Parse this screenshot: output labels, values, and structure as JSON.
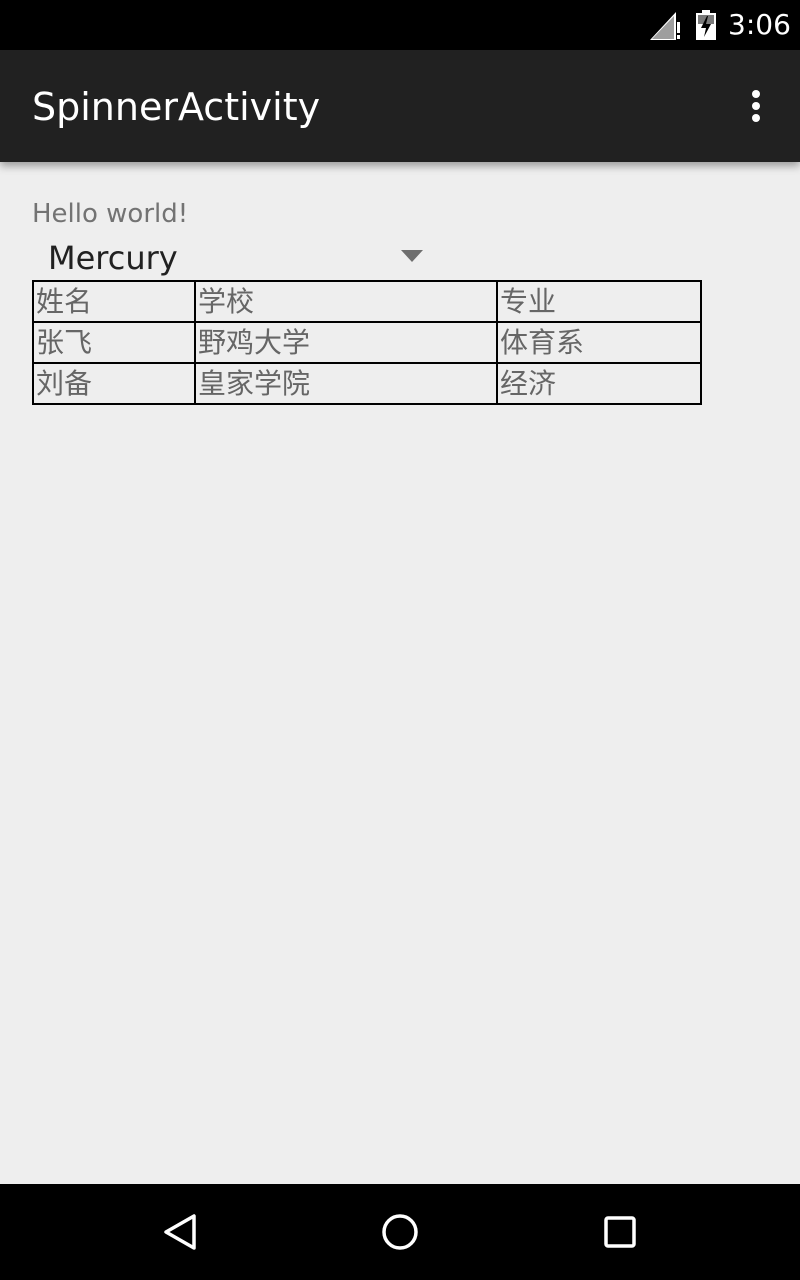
{
  "status_bar": {
    "time": "3:06",
    "icons": [
      "signal-no-data-icon",
      "battery-charging-icon"
    ]
  },
  "app_bar": {
    "title": "SpinnerActivity",
    "menu_icon": "overflow-menu-icon"
  },
  "content": {
    "hello_text": "Hello world!",
    "spinner": {
      "selected": "Mercury",
      "icon": "dropdown-arrow-icon"
    },
    "table": {
      "rows": [
        [
          "姓名",
          "学校",
          "专业"
        ],
        [
          "张飞",
          "野鸡大学",
          "体育系"
        ],
        [
          "刘备",
          "皇家学院",
          "经济"
        ]
      ]
    }
  },
  "nav_bar": {
    "icons": [
      "back-icon",
      "home-icon",
      "recents-icon"
    ]
  },
  "colors": {
    "status_bar": "#000000",
    "app_bar": "#212121",
    "background": "#eeeeee",
    "hello_text": "#737373",
    "table_text": "#666666",
    "table_border": "#000000"
  }
}
